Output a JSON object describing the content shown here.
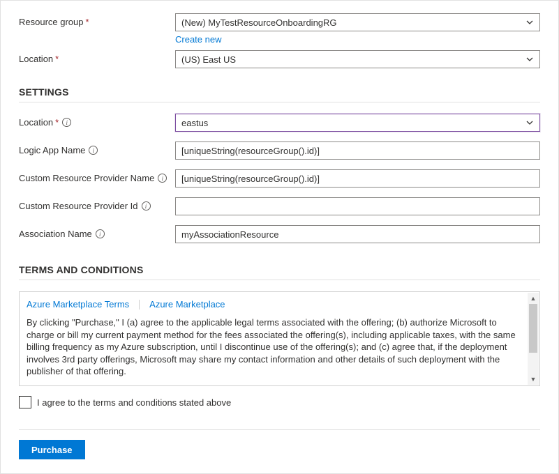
{
  "basics": {
    "resource_group": {
      "label": "Resource group",
      "value": "(New) MyTestResourceOnboardingRG",
      "create_new": "Create new"
    },
    "location": {
      "label": "Location",
      "value": "(US) East US"
    }
  },
  "settings": {
    "heading": "SETTINGS",
    "location": {
      "label": "Location",
      "value": "eastus"
    },
    "logic_app_name": {
      "label": "Logic App Name",
      "value": "[uniqueString(resourceGroup().id)]"
    },
    "crp_name": {
      "label": "Custom Resource Provider Name",
      "value": "[uniqueString(resourceGroup().id)]"
    },
    "crp_id": {
      "label": "Custom Resource Provider Id",
      "value": ""
    },
    "association_name": {
      "label": "Association Name",
      "value": "myAssociationResource"
    }
  },
  "terms": {
    "heading": "TERMS AND CONDITIONS",
    "tab1": "Azure Marketplace Terms",
    "tab2": "Azure Marketplace",
    "body": "By clicking \"Purchase,\" I (a) agree to the applicable legal terms associated with the offering; (b) authorize Microsoft to charge or bill my current payment method for the fees associated the offering(s), including applicable taxes, with the same billing frequency as my Azure subscription, until I discontinue use of the offering(s); and (c) agree that, if the deployment involves 3rd party offerings, Microsoft may share my contact information and other details of such deployment with the publisher of that offering.",
    "agree_label": "I agree to the terms and conditions stated above"
  },
  "footer": {
    "purchase": "Purchase"
  },
  "icons": {
    "info": "i"
  }
}
